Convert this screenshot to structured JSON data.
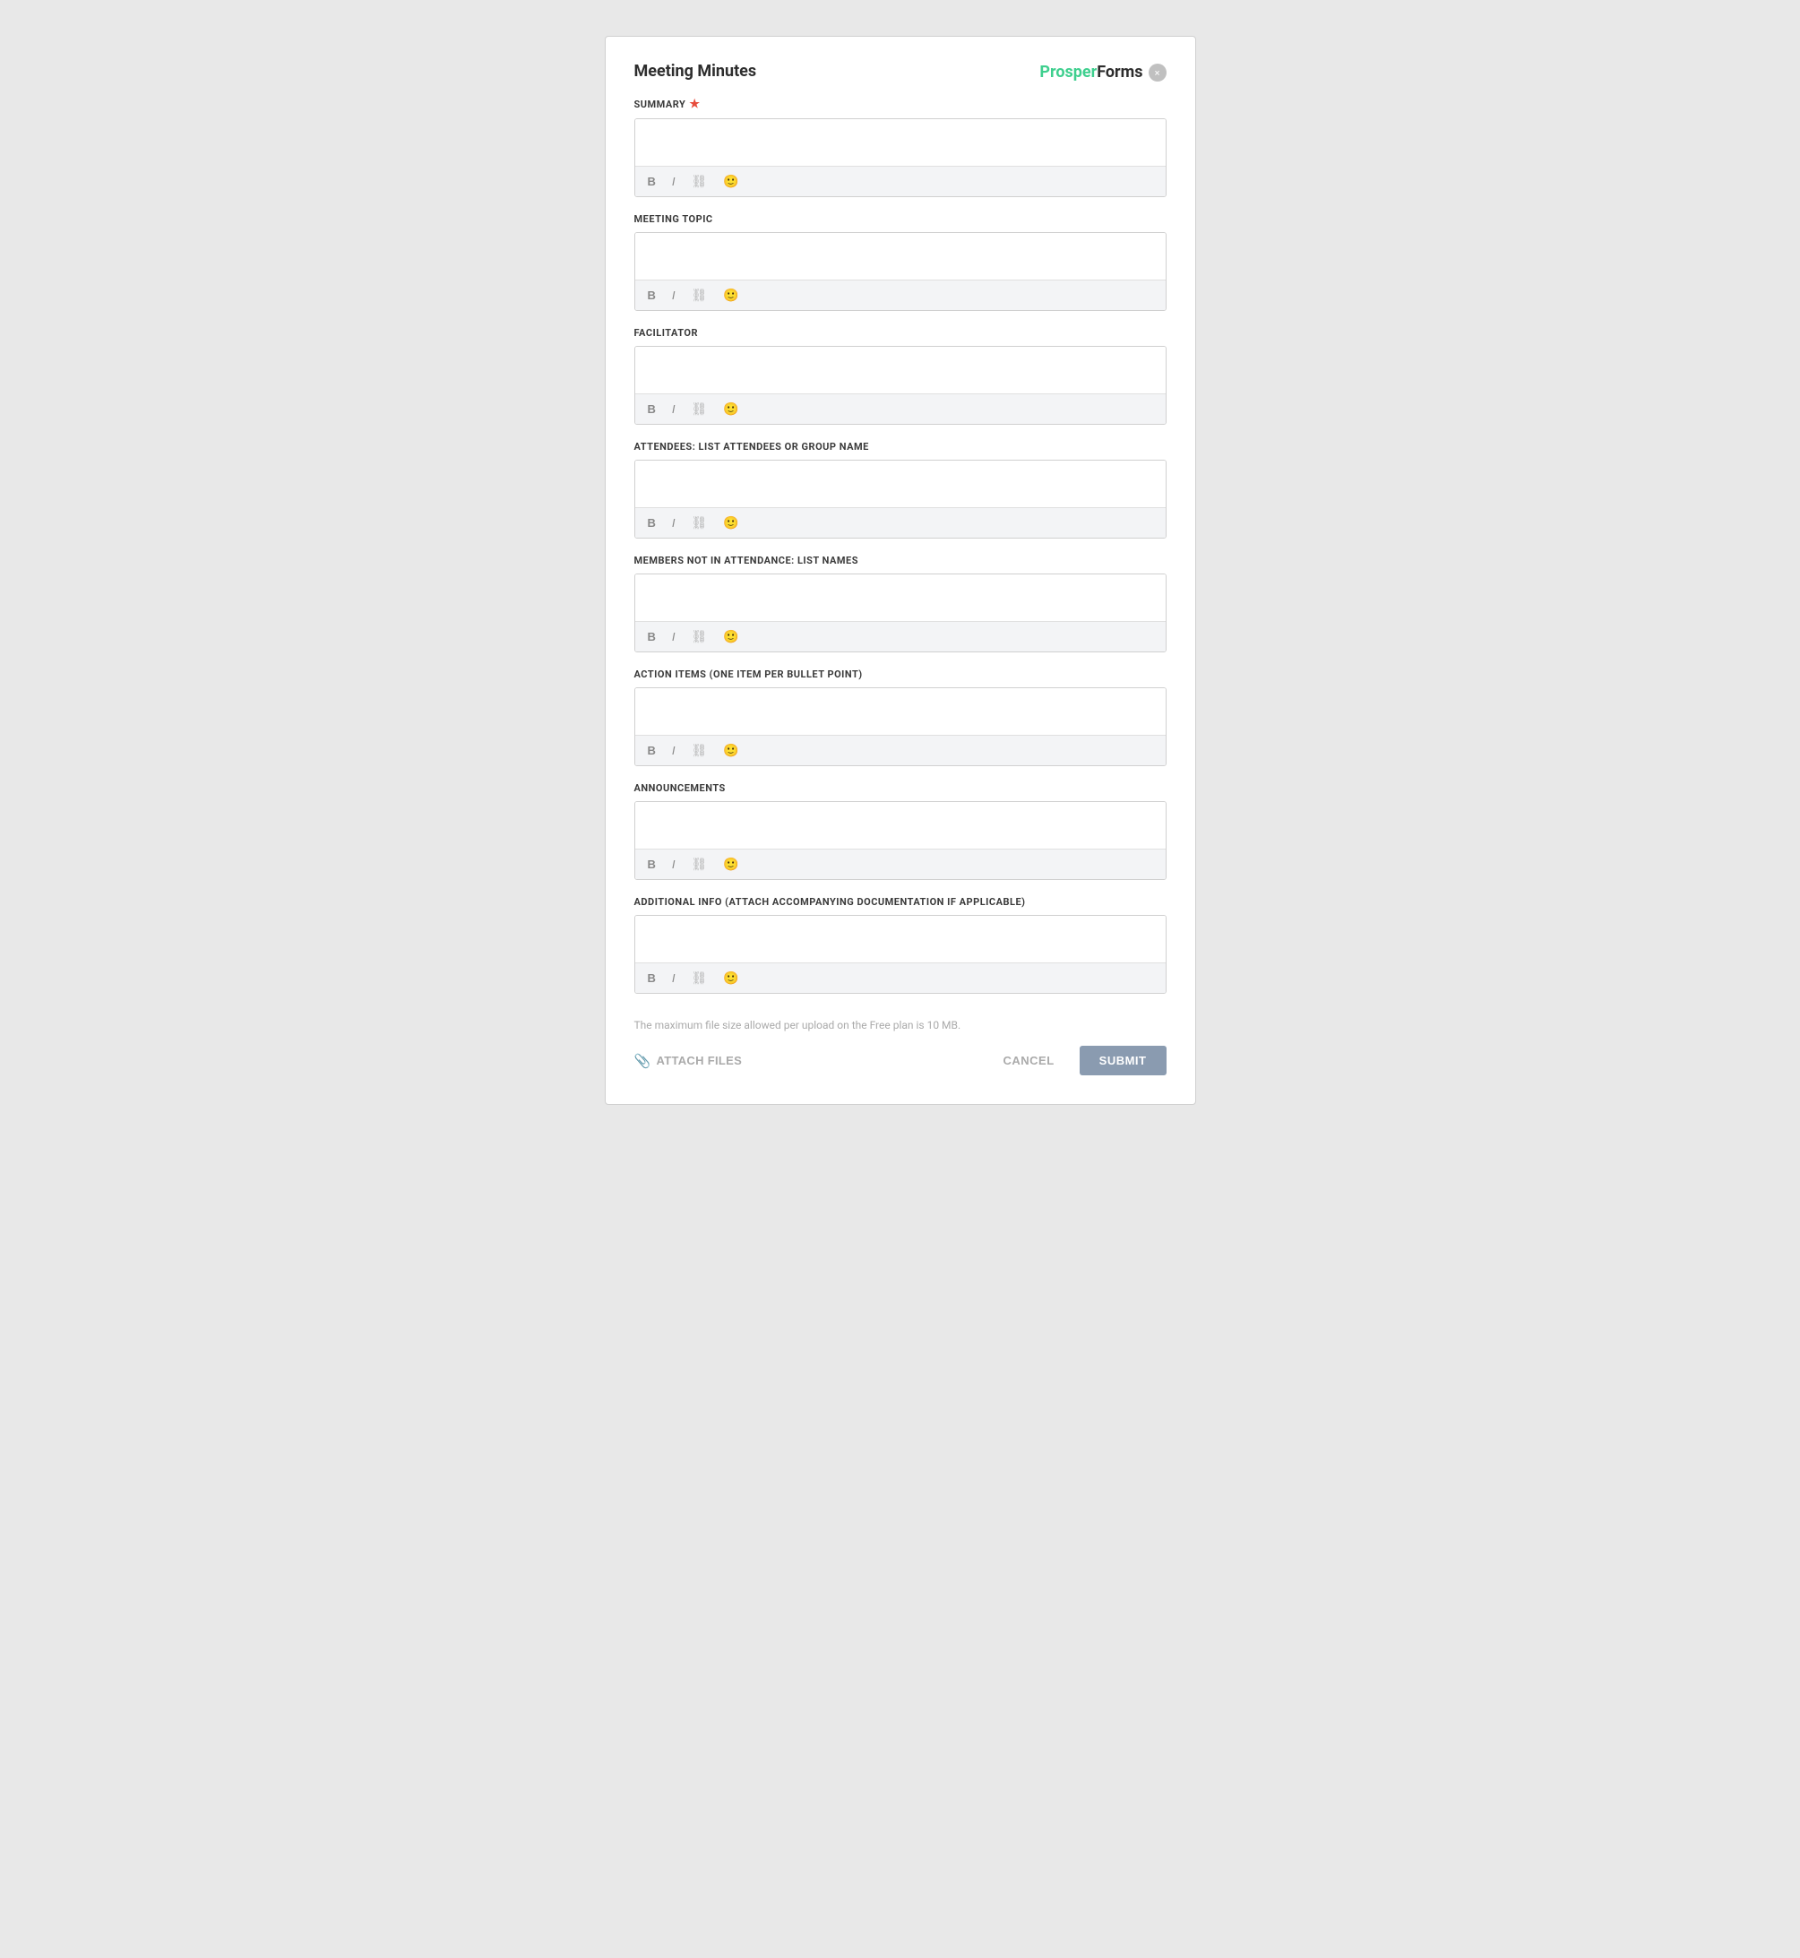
{
  "header": {
    "title": "Meeting Minutes",
    "logo_prosper": "Prosper",
    "logo_forms": "Forms",
    "close_label": "×"
  },
  "fields": [
    {
      "id": "summary",
      "label": "SUMMARY",
      "required": true,
      "toolbar": [
        "B",
        "I",
        "🔗",
        "🙂"
      ]
    },
    {
      "id": "meeting_topic",
      "label": "MEETING TOPIC",
      "required": false,
      "toolbar": [
        "B",
        "I",
        "🔗",
        "🙂"
      ]
    },
    {
      "id": "facilitator",
      "label": "FACILITATOR",
      "required": false,
      "toolbar": [
        "B",
        "I",
        "🔗",
        "🙂"
      ]
    },
    {
      "id": "attendees",
      "label": "ATTENDEES: LIST ATTENDEES OR GROUP NAME",
      "required": false,
      "toolbar": [
        "B",
        "I",
        "🔗",
        "🙂"
      ]
    },
    {
      "id": "members_not_in_attendance",
      "label": "MEMBERS NOT IN ATTENDANCE: LIST NAMES",
      "required": false,
      "toolbar": [
        "B",
        "I",
        "🔗",
        "🙂"
      ]
    },
    {
      "id": "action_items",
      "label": "ACTION ITEMS (ONE ITEM PER BULLET POINT)",
      "required": false,
      "toolbar": [
        "B",
        "I",
        "🔗",
        "🙂"
      ]
    },
    {
      "id": "announcements",
      "label": "ANNOUNCEMENTS",
      "required": false,
      "toolbar": [
        "B",
        "I",
        "🔗",
        "🙂"
      ]
    },
    {
      "id": "additional_info",
      "label": "ADDITIONAL INFO (ATTACH ACCOMPANYING DOCUMENTATION IF APPLICABLE)",
      "required": false,
      "toolbar": [
        "B",
        "I",
        "🔗",
        "🙂"
      ]
    }
  ],
  "footer": {
    "file_size_note": "The maximum file size allowed per upload on the Free plan is 10 MB.",
    "attach_files_label": "ATTACH FILES",
    "cancel_label": "CANCEL",
    "submit_label": "SUBMIT"
  }
}
